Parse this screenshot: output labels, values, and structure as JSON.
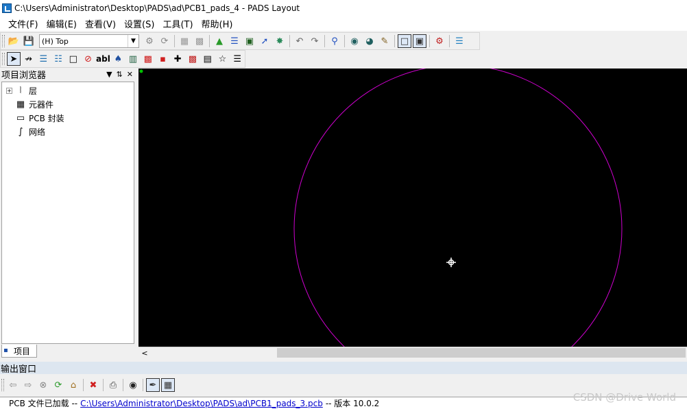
{
  "window": {
    "title": "C:\\Users\\Administrator\\Desktop\\PADS\\ad\\PCB1_pads_4 - PADS Layout"
  },
  "menu": [
    "文件(F)",
    "编辑(E)",
    "查看(V)",
    "设置(S)",
    "工具(T)",
    "帮助(H)"
  ],
  "toolbar": {
    "layer_value": "(H) Top"
  },
  "toolbar2": {
    "text_tool_label": "abl"
  },
  "project_browser": {
    "title": "项目浏览器",
    "items": [
      {
        "label": "层",
        "icon": "layers-icon"
      },
      {
        "label": "元器件",
        "icon": "component-icon"
      },
      {
        "label": "PCB 封装",
        "icon": "footprint-icon"
      },
      {
        "label": "网络",
        "icon": "net-icon"
      }
    ],
    "tab_label": "项目"
  },
  "output": {
    "title": "输出窗口",
    "message_prefix": "PCB 文件已加载  --",
    "message_path": "C:\\Users\\Administrator\\Desktop\\PADS\\ad\\PCB1_pads_3.pcb",
    "message_suffix": "--  版本  10.0.2"
  },
  "watermark": "CSDN @Drive World",
  "colors": {
    "canvas_bg": "#000000",
    "board_outline": "#d000d0",
    "crosshair": "#ffffff",
    "origin_marker": "#00c000"
  }
}
